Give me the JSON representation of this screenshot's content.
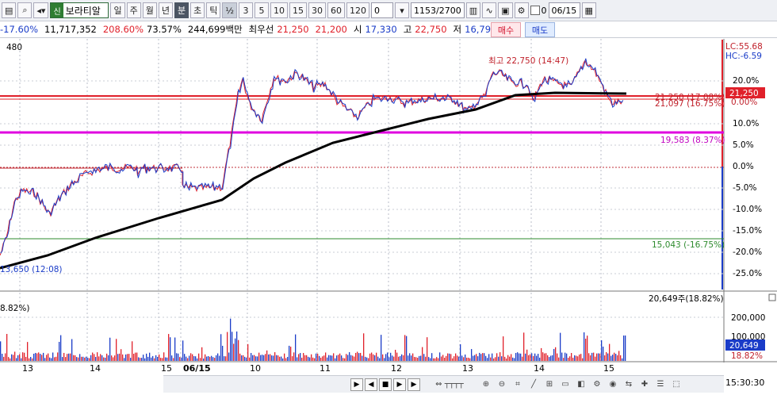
{
  "toolbar": {
    "stock_tag": "신",
    "stock_name": "보라티알",
    "periods": [
      "일",
      "주",
      "월",
      "년",
      "분",
      "초",
      "틱"
    ],
    "fraction": "½",
    "intervals": [
      "3",
      "5",
      "10",
      "15",
      "30",
      "60",
      "120"
    ],
    "custom_interval": "0",
    "count": "1153/2700",
    "checkbox_label": "0",
    "date": "06/15"
  },
  "quote": {
    "change_pct": "-17.60%",
    "volume": "11,717,352",
    "vol_ratio": "208.60%",
    "turnover": "73.57%",
    "amount": "244,699백만",
    "best_ask_label": "최우선",
    "best_ask": "21,250",
    "best_bid": "21,200",
    "open_label": "시",
    "open": "17,330",
    "high_label": "고",
    "high": "22,750",
    "low_label": "저",
    "low": "16,790",
    "buy_label": "매수",
    "sell_label": "매도"
  },
  "price_panel": {
    "top_left": "480",
    "lc": "LC:55.68",
    "hc": "HC:-6.59",
    "current_price": "21,250",
    "high_note": "최고 22,750 (14:47)",
    "low_note": "13,650 (12:08)",
    "line_note_1": "21,250 (17.08%)",
    "line_note_2": "21,097 (16.75%)",
    "line_note_3": "19,583 (8.37%)",
    "line_note_4": "15,043 (-16.75%)",
    "y_ticks": [
      "20.0%",
      "15.0%",
      "10.0%",
      "5.0%",
      "0.0%",
      "-5.0%",
      "-10.0%",
      "-15.0%",
      "-20.0%",
      "-25.0%"
    ],
    "zero_tick": "0.00%"
  },
  "volume_panel": {
    "left_label": "8.82%)",
    "right_label": "20,649주(18.82%)",
    "y_tick_1": "200,000",
    "y_tick_2": "100,000",
    "current": "20,649",
    "pct": "18.82%"
  },
  "x_axis": {
    "labels": [
      "13",
      "14",
      "15",
      "06/15",
      "10",
      "11",
      "12",
      "13",
      "14",
      "15"
    ],
    "time": "15:30:30"
  },
  "colors": {
    "up": "#e0202a",
    "down": "#1a3cc8",
    "ma": "#000000",
    "magenta": "#e000e0",
    "green": "#2e8b2e"
  }
}
